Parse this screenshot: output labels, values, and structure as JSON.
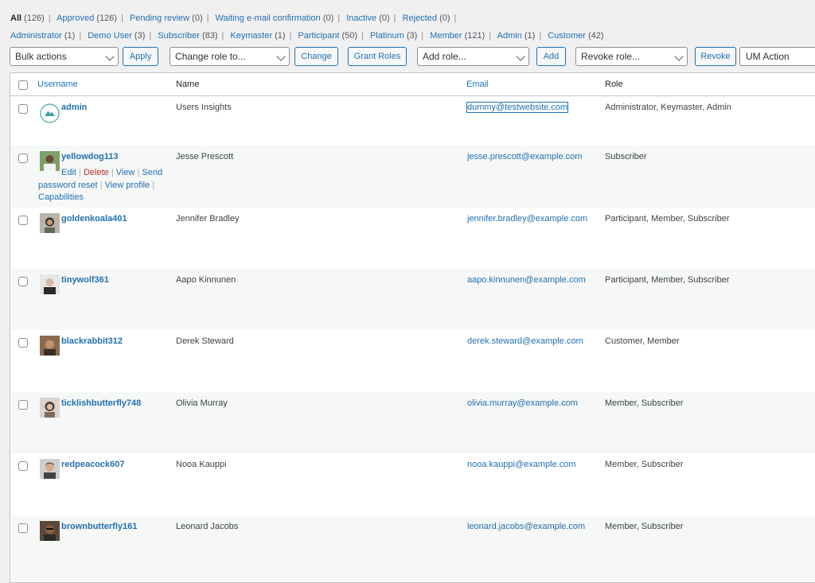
{
  "status_filters": [
    {
      "label": "All",
      "count": "(126)"
    },
    {
      "label": "Approved",
      "count": "(126)"
    },
    {
      "label": "Pending review",
      "count": "(0)"
    },
    {
      "label": "Waiting e-mail confirmation",
      "count": "(0)"
    },
    {
      "label": "Inactive",
      "count": "(0)"
    },
    {
      "label": "Rejected",
      "count": "(0)"
    }
  ],
  "role_filters": [
    {
      "label": "Administrator",
      "count": "(1)"
    },
    {
      "label": "Demo User",
      "count": "(3)"
    },
    {
      "label": "Subscriber",
      "count": "(83)"
    },
    {
      "label": "Keymaster",
      "count": "(1)"
    },
    {
      "label": "Participant",
      "count": "(50)"
    },
    {
      "label": "Platinum",
      "count": "(3)"
    },
    {
      "label": "Member",
      "count": "(121)"
    },
    {
      "label": "Admin",
      "count": "(1)"
    },
    {
      "label": "Customer",
      "count": "(42)"
    }
  ],
  "toolbar": {
    "bulk_actions": "Bulk actions",
    "apply": "Apply",
    "change_role": "Change role to...",
    "change": "Change",
    "grant_roles": "Grant Roles",
    "add_role": "Add role...",
    "add": "Add",
    "revoke_role": "Revoke role...",
    "revoke": "Revoke",
    "um_action": "UM Action"
  },
  "columns": {
    "username": "Username",
    "name": "Name",
    "email": "Email",
    "role": "Role"
  },
  "row_actions": {
    "edit": "Edit",
    "delete": "Delete",
    "view": "View",
    "send_reset_1": "Send",
    "send_reset_2": "password reset",
    "view_profile": "View profile",
    "capabilities": "Capabilities"
  },
  "users": [
    {
      "username": "admin",
      "name": "Users Insights",
      "email": "dummy@testwebsite.com",
      "role": "Administrator, Keymaster, Admin",
      "avatar": "logo-icon"
    },
    {
      "username": "yellowdog113",
      "name": "Jesse Prescott",
      "email": "jesse.prescott@example.com",
      "role": "Subscriber",
      "avatar": "photo"
    },
    {
      "username": "goldenkoala401",
      "name": "Jennifer Bradley",
      "email": "jennifer.bradley@example.com",
      "role": "Participant, Member, Subscriber",
      "avatar": "photo"
    },
    {
      "username": "tinywolf361",
      "name": "Aapo Kinnunen",
      "email": "aapo.kinnunen@example.com",
      "role": "Participant, Member, Subscriber",
      "avatar": "photo"
    },
    {
      "username": "blackrabbit312",
      "name": "Derek Steward",
      "email": "derek.steward@example.com",
      "role": "Customer, Member",
      "avatar": "photo"
    },
    {
      "username": "ticklishbutterfly748",
      "name": "Olivia Murray",
      "email": "olivia.murray@example.com",
      "role": "Member, Subscriber",
      "avatar": "photo"
    },
    {
      "username": "redpeacock607",
      "name": "Nooa Kauppi",
      "email": "nooa.kauppi@example.com",
      "role": "Member, Subscriber",
      "avatar": "photo"
    },
    {
      "username": "brownbutterfly161",
      "name": "Leonard Jacobs",
      "email": "leonard.jacobs@example.com",
      "role": "Member, Subscriber",
      "avatar": "photo"
    }
  ]
}
